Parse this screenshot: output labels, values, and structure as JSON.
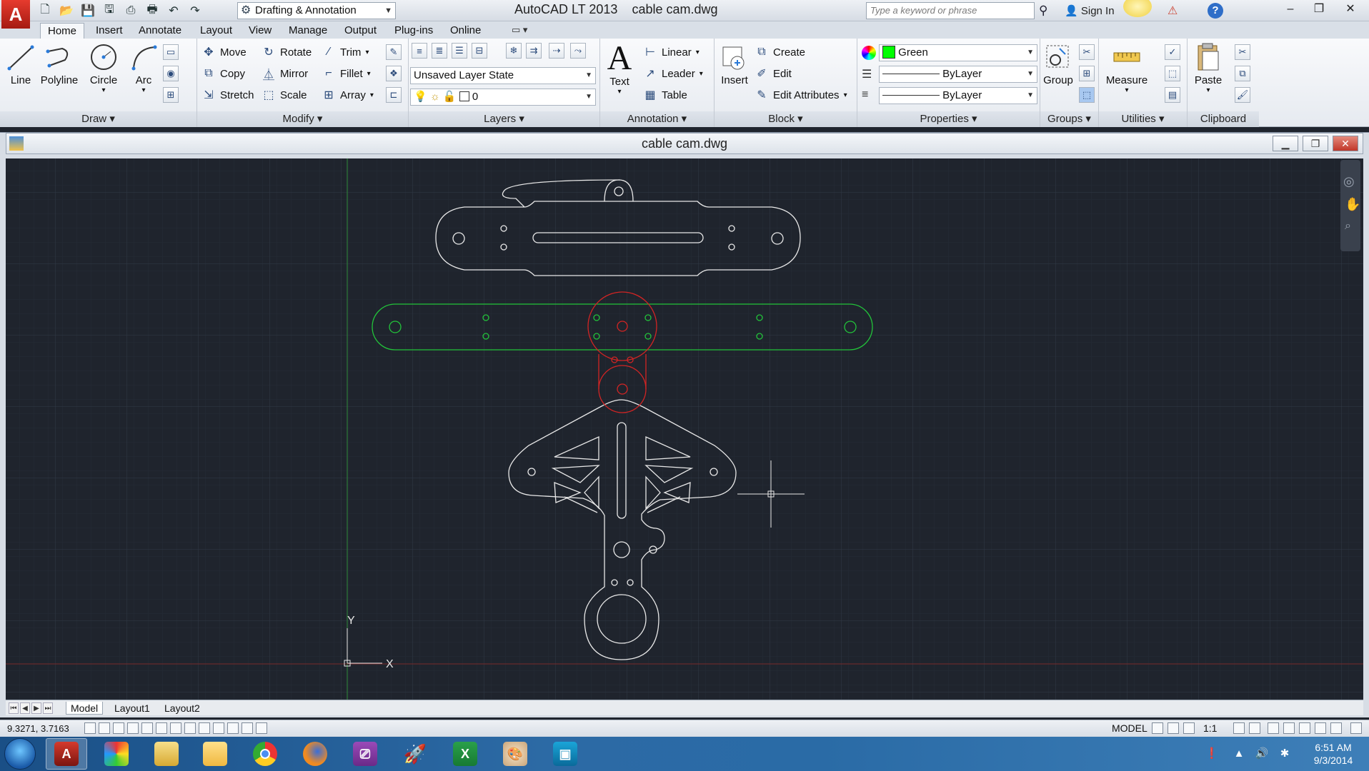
{
  "title_bar": {
    "app_logo": "A",
    "workspace": "Drafting & Annotation",
    "app_name": "AutoCAD LT 2013",
    "file_name": "cable cam.dwg",
    "search_placeholder": "Type a keyword or phrase",
    "sign_in": "Sign In",
    "help": "?",
    "controls": [
      "–",
      "❐",
      "✕"
    ]
  },
  "ribbon_tabs": [
    "Home",
    "Insert",
    "Annotate",
    "Layout",
    "View",
    "Manage",
    "Output",
    "Plug-ins",
    "Online"
  ],
  "active_tab": "Home",
  "panels": {
    "draw": {
      "title": "Draw",
      "tools": [
        "Line",
        "Polyline",
        "Circle",
        "Arc"
      ]
    },
    "modify": {
      "title": "Modify",
      "rows": [
        [
          "Move",
          "Rotate",
          "Trim"
        ],
        [
          "Copy",
          "Mirror",
          "Fillet"
        ],
        [
          "Stretch",
          "Scale",
          "Array"
        ]
      ]
    },
    "layers": {
      "title": "Layers",
      "layer_state": "Unsaved Layer State",
      "current_layer": "0"
    },
    "annotation": {
      "title": "Annotation",
      "text": "Text",
      "tools": [
        "Linear",
        "Leader",
        "Table"
      ]
    },
    "block": {
      "title": "Block",
      "insert": "Insert",
      "tools": [
        "Create",
        "Edit",
        "Edit Attributes"
      ]
    },
    "properties": {
      "title": "Properties",
      "color": "Green",
      "color_hex": "#00ff00",
      "linetype": "ByLayer",
      "lineweight": "ByLayer"
    },
    "groups": {
      "title": "Groups",
      "group": "Group"
    },
    "utilities": {
      "title": "Utilities",
      "measure": "Measure"
    },
    "clipboard": {
      "title": "Clipboard",
      "paste": "Paste"
    }
  },
  "drawing_window": {
    "title": "cable cam.dwg",
    "ucs_x": "X",
    "ucs_y": "Y",
    "colors": {
      "background": "#1f242d",
      "grid": "#2c333e",
      "geometry_white": "#e8e8e8",
      "geometry_green": "#22c33a",
      "geometry_red": "#d22424"
    }
  },
  "layout_tabs": [
    "Model",
    "Layout1",
    "Layout2"
  ],
  "active_layout": "Model",
  "status_bar": {
    "coordinates": "9.3271, 3.7163",
    "model": "MODEL",
    "scale": "1:1"
  },
  "taskbar": {
    "apps": [
      "autocad-lt",
      "paint-colors",
      "file-explorer",
      "outlook-notes",
      "chrome",
      "firefox",
      "remote-app",
      "rocket-app",
      "excel",
      "paint",
      "media-app"
    ],
    "active_app": "autocad-lt",
    "time": "6:51 AM",
    "date": "9/3/2014"
  }
}
